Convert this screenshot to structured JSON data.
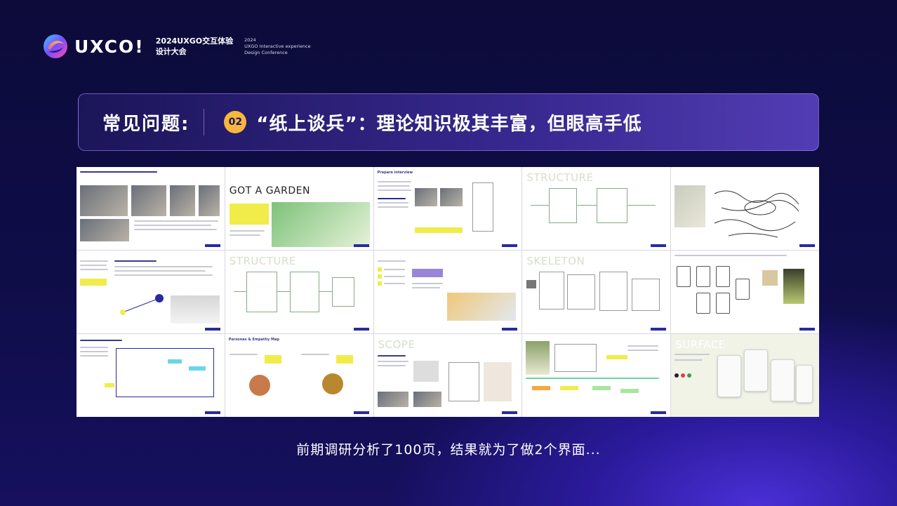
{
  "brand": {
    "name": "UXCO!",
    "conference_cn_line1": "2024UXGO交互体验",
    "conference_cn_line2": "设计大会",
    "conference_en_line1": "2024",
    "conference_en_line2": "UXGO Interactive experience",
    "conference_en_line3": "Design Conference"
  },
  "banner": {
    "label": "常见问题:",
    "number": "02",
    "title": "“纸上谈兵”：理论知识极其丰富，但眼高手低"
  },
  "slides": [
    {
      "tag": "",
      "heading": ""
    },
    {
      "tag": "",
      "heading": "GOT A GARDEN"
    },
    {
      "tag": "Prepare interview",
      "heading": ""
    },
    {
      "tag": "",
      "heading": "STRUCTURE"
    },
    {
      "tag": "",
      "heading": ""
    },
    {
      "tag": "",
      "heading": ""
    },
    {
      "tag": "",
      "heading": "STRUCTURE"
    },
    {
      "tag": "",
      "heading": ""
    },
    {
      "tag": "",
      "heading": "SKELETON"
    },
    {
      "tag": "",
      "heading": ""
    },
    {
      "tag": "",
      "heading": ""
    },
    {
      "tag": "Personas & Empathy Map",
      "heading": ""
    },
    {
      "tag": "",
      "heading": "SCOPE"
    },
    {
      "tag": "",
      "heading": ""
    },
    {
      "tag": "",
      "heading": "SURFACE"
    }
  ],
  "caption": "前期调研分析了100页，结果就为了做2个界面..."
}
